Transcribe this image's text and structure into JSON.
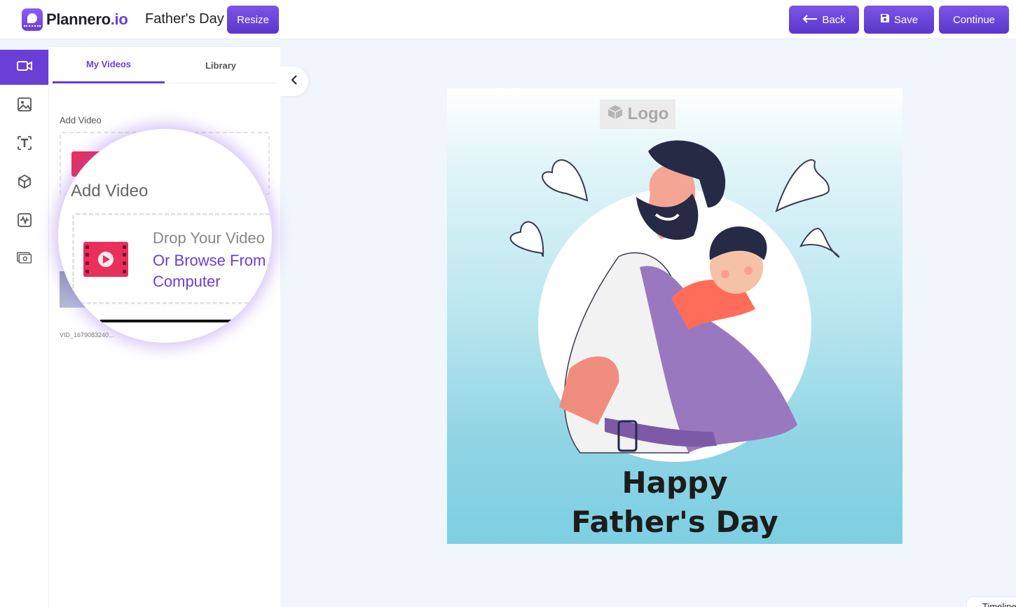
{
  "header": {
    "logo_text": "Plannero",
    "logo_suffix": ".io",
    "doc_title": "Father's Day",
    "resize_label": "Resize",
    "back_label": "Back",
    "save_label": "Save",
    "continue_label": "Continue"
  },
  "rail": {
    "items": [
      {
        "icon": "video-camera-icon",
        "active": true
      },
      {
        "icon": "image-icon",
        "active": false
      },
      {
        "icon": "text-icon",
        "active": false
      },
      {
        "icon": "cube-icon",
        "active": false
      },
      {
        "icon": "audio-wave-icon",
        "active": false
      },
      {
        "icon": "money-stack-icon",
        "active": false
      }
    ]
  },
  "panel": {
    "tabs": [
      {
        "label": "My Videos",
        "active": true
      },
      {
        "label": "Library",
        "active": false
      }
    ],
    "add_video_label": "Add Video",
    "video_name": "VID_1679083240..."
  },
  "magnifier": {
    "title": "Add Video",
    "drop_text": "Drop Your Video",
    "browse_line1": "Or Browse From",
    "browse_line2": "Computer"
  },
  "canvas": {
    "logo_placeholder": "Logo",
    "greeting_line1": "Happy",
    "greeting_line2": "Father's Day"
  },
  "footer": {
    "timeline_label": "Timeline"
  },
  "colors": {
    "accent": "#6a3fd8",
    "film_icon": "#e8305a"
  }
}
